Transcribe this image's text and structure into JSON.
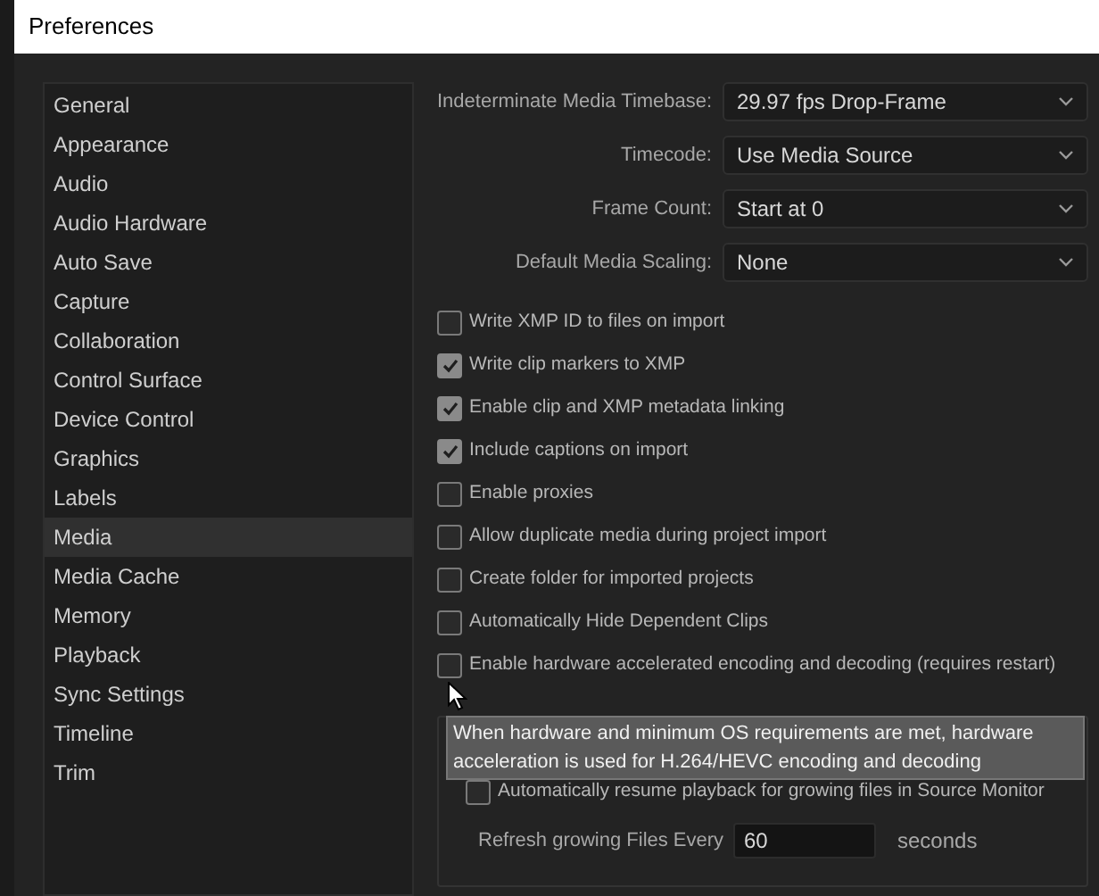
{
  "window": {
    "title": "Preferences"
  },
  "sidebar": {
    "items": [
      {
        "label": "General",
        "selected": false
      },
      {
        "label": "Appearance",
        "selected": false
      },
      {
        "label": "Audio",
        "selected": false
      },
      {
        "label": "Audio Hardware",
        "selected": false
      },
      {
        "label": "Auto Save",
        "selected": false
      },
      {
        "label": "Capture",
        "selected": false
      },
      {
        "label": "Collaboration",
        "selected": false
      },
      {
        "label": "Control Surface",
        "selected": false
      },
      {
        "label": "Device Control",
        "selected": false
      },
      {
        "label": "Graphics",
        "selected": false
      },
      {
        "label": "Labels",
        "selected": false
      },
      {
        "label": "Media",
        "selected": true
      },
      {
        "label": "Media Cache",
        "selected": false
      },
      {
        "label": "Memory",
        "selected": false
      },
      {
        "label": "Playback",
        "selected": false
      },
      {
        "label": "Sync Settings",
        "selected": false
      },
      {
        "label": "Timeline",
        "selected": false
      },
      {
        "label": "Trim",
        "selected": false
      }
    ]
  },
  "dropdowns": [
    {
      "label": "Indeterminate Media Timebase:",
      "value": "29.97 fps Drop-Frame"
    },
    {
      "label": "Timecode:",
      "value": "Use Media Source"
    },
    {
      "label": "Frame Count:",
      "value": "Start at 0"
    },
    {
      "label": "Default Media Scaling:",
      "value": "None"
    }
  ],
  "checkboxes": [
    {
      "label": "Write XMP ID to files on import",
      "checked": false
    },
    {
      "label": "Write clip markers to XMP",
      "checked": true
    },
    {
      "label": "Enable clip and XMP metadata linking",
      "checked": true
    },
    {
      "label": "Include captions on import",
      "checked": true
    },
    {
      "label": "Enable proxies",
      "checked": false
    },
    {
      "label": "Allow duplicate media during project import",
      "checked": false
    },
    {
      "label": "Create folder for imported projects",
      "checked": false
    },
    {
      "label": "Automatically Hide Dependent Clips",
      "checked": false
    },
    {
      "label": "Enable hardware accelerated encoding and decoding (requires restart)",
      "checked": false
    }
  ],
  "tooltip": "When hardware and minimum OS requirements are met, hardware acceleration is used for H.264/HEVC encoding and decoding",
  "growing_files": {
    "checkbox": {
      "label": "Automatically resume playback for growing files in Source Monitor",
      "checked": false
    },
    "refresh": {
      "label": "Refresh growing Files Every",
      "value": "60",
      "unit": "seconds"
    }
  }
}
